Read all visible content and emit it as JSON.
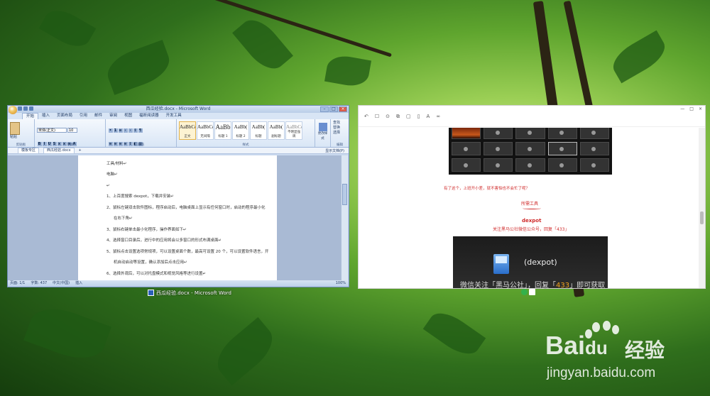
{
  "word": {
    "title": "西瓜经验.docx - Microsoft Word",
    "tabs": [
      "开始",
      "插入",
      "页面布局",
      "引用",
      "邮件",
      "审阅",
      "视图",
      "福昕阅读器",
      "开发工具"
    ],
    "font_name": "宋体(正文)",
    "font_size": "10",
    "paste_label": "粘贴",
    "group_labels": [
      "剪贴板",
      "字体",
      "段落",
      "样式",
      "编辑"
    ],
    "styles": [
      {
        "preview": "AaBbCcDd",
        "name": "正文"
      },
      {
        "preview": "AaBbCcDd",
        "name": "无间隔"
      },
      {
        "preview": "AaBb",
        "name": "标题 1"
      },
      {
        "preview": "AaBb(",
        "name": "标题 2"
      },
      {
        "preview": "AaBb(",
        "name": "标题"
      },
      {
        "preview": "AaBb(",
        "name": "副标题"
      },
      {
        "preview": "AaBbCcDd",
        "name": "不明显强调"
      }
    ],
    "change_styles": "更改样式",
    "edit_items": [
      "查找",
      "替换",
      "选择"
    ],
    "file_tabs": [
      "模板专区",
      "西瓜经验.docx"
    ],
    "file_tabs_right": "显示文档(P)",
    "doc_lines": [
      {
        "text": "工具/材料↵",
        "indent": false
      },
      {
        "text": "电脑↵",
        "indent": false
      },
      {
        "text": "↵",
        "indent": false
      },
      {
        "text": "1、上百度搜索 dexpot，下载并安装↵",
        "indent": false
      },
      {
        "text": "2、鼠标左键双击软件图标，程序启动后，电脑桌面上显示有任何窗口时，启动的程序最小化",
        "indent": false
      },
      {
        "text": "在右下角↵",
        "indent": true
      },
      {
        "text": "3、鼠标右键单击最小化程序，操作界面如下↵",
        "indent": false
      },
      {
        "text": "4、选择窗口目录后，进行中的应用将会以多窗口的形式布满桌面↵",
        "indent": false
      },
      {
        "text": "5、鼠标点击设置选项常规项，可以设置桌面个数，最高可设置 20 个，可以设置软件语言，开",
        "indent": false
      },
      {
        "text": "机自动启动等设置，确认添加后点击应用↵",
        "indent": true
      },
      {
        "text": "6、选择外观后，可以对托盘模式和视觉风格等进行设置↵",
        "indent": false
      },
      {
        "text": "7、选择额外后，可以进行软件增加设置↵",
        "indent": false
      },
      {
        "text": "8、选择新插件，可以对软件键盘快捷方式进行设置，以切换桌面设置快捷键↵",
        "indent": false
      }
    ],
    "status": {
      "page": "页面: 1/1",
      "words": "字数: 437",
      "lang": "中文(中国)",
      "mode": "插入",
      "zoom": "100%"
    }
  },
  "browser": {
    "tools": [
      "↶",
      "☐",
      "⊙",
      "⧉",
      "▢",
      "▯",
      "A",
      "∞"
    ],
    "window_controls": [
      "—",
      "□",
      "×"
    ],
    "red_note": "有了这个，上班开小差，就不害怕也不会忙了呢？",
    "section_tag": "所需工具",
    "app_name": "dexpot",
    "app_desc": "关注黑马公社微信公众号，回复「433」",
    "promo_name": "(dexpot)",
    "promo_line_prefix": "微信关注「黑马公社」，回复「",
    "promo_number": "433",
    "promo_line_suffix": "」即可获取"
  },
  "taskbar": {
    "word_label": "西瓜经验.docx - Microsoft Word"
  },
  "watermark": {
    "brand": "Bai",
    "brand_du": "du",
    "brand_cn": "经验",
    "url": "jingyan.baidu.com"
  }
}
